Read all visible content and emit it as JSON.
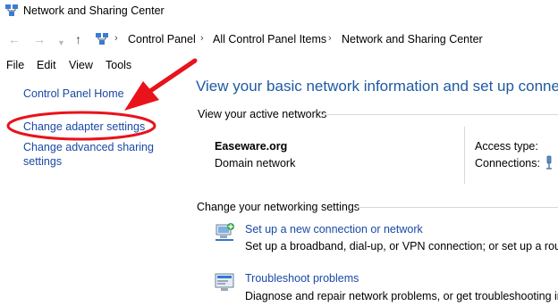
{
  "window": {
    "title": "Network and Sharing Center"
  },
  "nav": {
    "back_icon": "left-arrow-icon",
    "forward_icon": "right-arrow-icon",
    "recent_icon": "chevron-down-icon",
    "up_icon": "up-arrow-icon",
    "breadcrumb": [
      "Control Panel",
      "All Control Panel Items",
      "Network and Sharing Center"
    ]
  },
  "menu": [
    "File",
    "Edit",
    "View",
    "Tools"
  ],
  "sidebar": {
    "home": "Control Panel Home",
    "adapter": "Change adapter settings",
    "advanced_line1": "Change advanced sharing",
    "advanced_line2": "settings"
  },
  "main": {
    "heading": "View your basic network information and set up connectio",
    "active_networks_label": "View your active networks",
    "network": {
      "name": "Easeware.org",
      "type": "Domain network",
      "access_label": "Access type:",
      "connections_label": "Connections:"
    },
    "change_settings_label": "Change your networking settings",
    "items": [
      {
        "title": "Set up a new connection or network",
        "desc": "Set up a broadband, dial-up, or VPN connection; or set up a router",
        "icon": "new-connection-icon"
      },
      {
        "title": "Troubleshoot problems",
        "desc": "Diagnose and repair network problems, or get troubleshooting info",
        "icon": "troubleshoot-icon"
      }
    ]
  },
  "annotations": {
    "arrow_color": "#e8131b",
    "highlight_color": "#e8131b"
  }
}
